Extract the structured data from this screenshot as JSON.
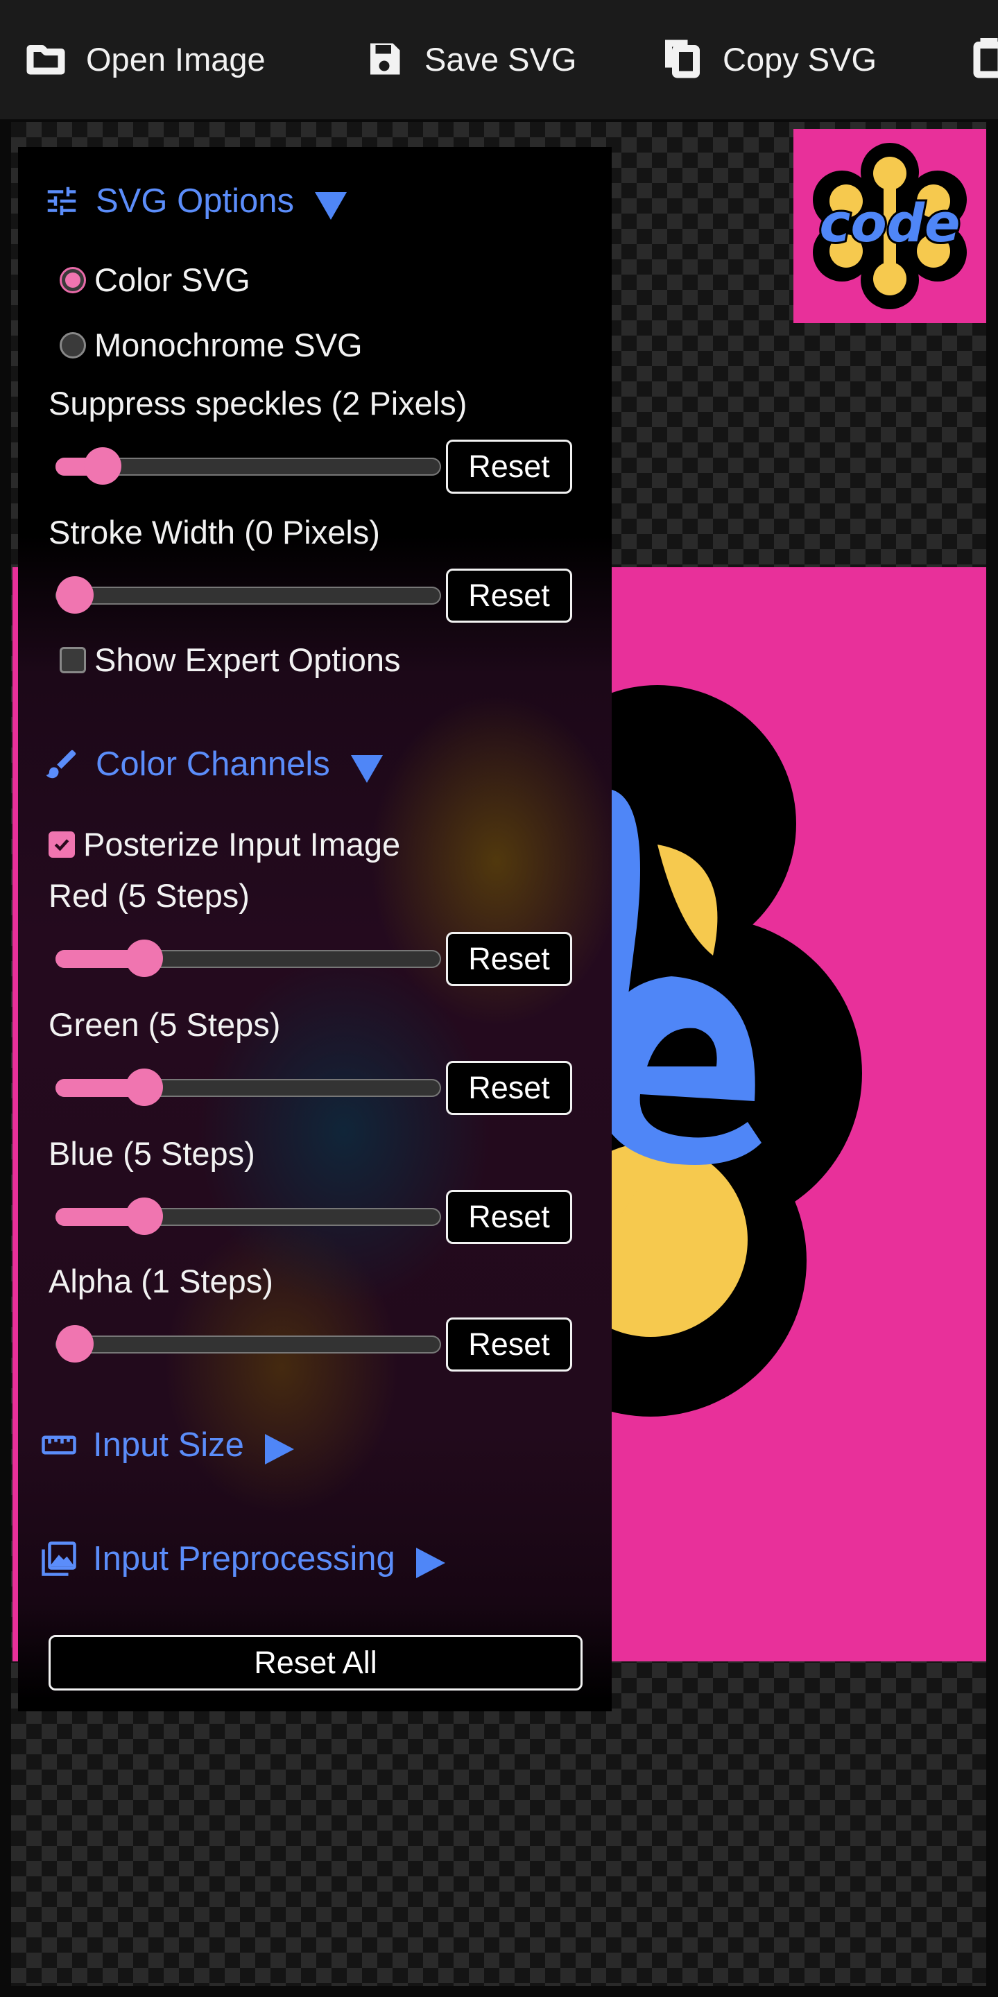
{
  "toolbar": {
    "open_image": "Open Image",
    "save_svg": "Save SVG",
    "copy_svg": "Copy SVG"
  },
  "preview": {
    "logo_text": "code",
    "colors": {
      "background": "#e8309a",
      "blue": "#4f86f7",
      "yellow": "#f6c94e",
      "outline": "#000000"
    }
  },
  "panel": {
    "svg_options": {
      "title": "SVG Options",
      "color_svg": "Color SVG",
      "monochrome_svg": "Monochrome SVG",
      "selected_mode": "Color SVG",
      "speckles_label": "Suppress speckles (2 Pixels)",
      "speckles_value": 0.08,
      "stroke_label": "Stroke Width (0 Pixels)",
      "stroke_value": 0.0,
      "expert_label": "Show Expert Options",
      "expert_checked": false,
      "reset_label": "Reset"
    },
    "color_channels": {
      "title": "Color Channels",
      "posterize_label": "Posterize Input Image",
      "posterize_checked": true,
      "red_label": "Red (5 Steps)",
      "red_value": 0.2,
      "green_label": "Green (5 Steps)",
      "green_value": 0.2,
      "blue_label": "Blue (5 Steps)",
      "blue_value": 0.2,
      "alpha_label": "Alpha (1 Steps)",
      "alpha_value": 0.0,
      "reset_label": "Reset"
    },
    "input_size": {
      "title": "Input Size"
    },
    "input_preprocessing": {
      "title": "Input Preprocessing"
    },
    "reset_all": "Reset All"
  },
  "accent_colors": {
    "link_blue": "#5b8dfa",
    "slider_pink": "#f075b0"
  }
}
